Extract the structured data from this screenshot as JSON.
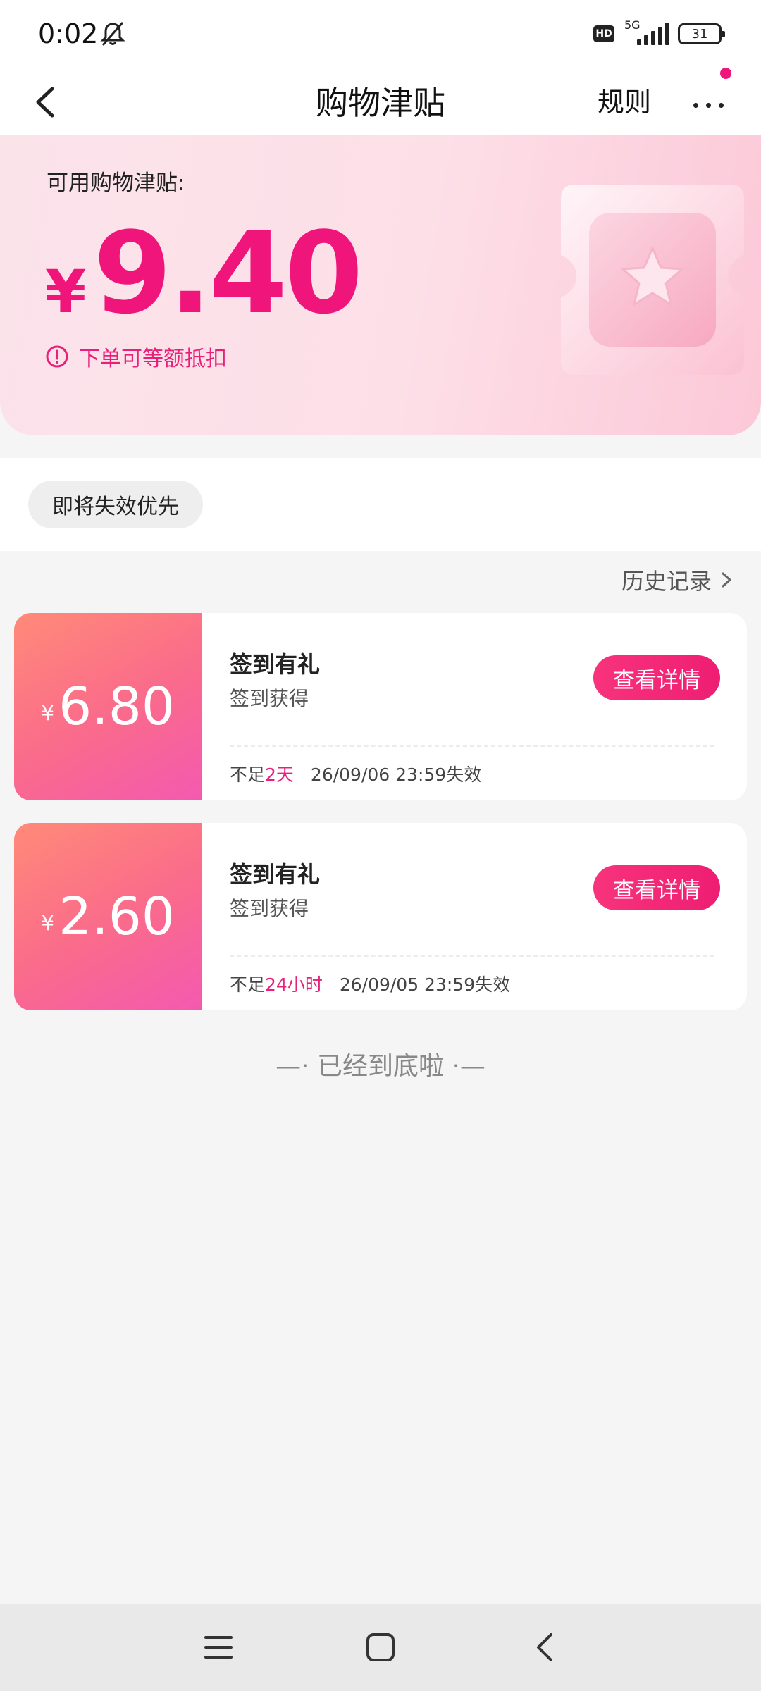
{
  "status_bar": {
    "time": "0:02",
    "network_type": "5G",
    "hd_label": "HD",
    "battery_level": "31",
    "icons": [
      "bell-muted-icon",
      "hd-icon",
      "signal-icon",
      "battery-icon"
    ]
  },
  "nav": {
    "title": "购物津贴",
    "rule_label": "规则",
    "has_notification_dot": true
  },
  "hero": {
    "label": "可用购物津贴:",
    "currency": "¥",
    "amount": "9.40",
    "note": "下单可等额抵扣"
  },
  "filter": {
    "chip_label": "即将失效优先"
  },
  "history_link": "历史记录",
  "coupons": [
    {
      "currency": "¥",
      "amount": "6.80",
      "title": "签到有礼",
      "subtitle": "签到获得",
      "button": "查看详情",
      "prefix": "不足",
      "remaining": "2天",
      "expiry": "26/09/06 23:59失效"
    },
    {
      "currency": "¥",
      "amount": "2.60",
      "title": "签到有礼",
      "subtitle": "签到获得",
      "button": "查看详情",
      "prefix": "不足",
      "remaining": "24小时",
      "expiry": "26/09/05 23:59失效"
    }
  ],
  "end_text": "—· 已经到底啦 ·—",
  "colors": {
    "accent": "#f0157a",
    "card_gradient_start": "#ff8a78",
    "card_gradient_end": "#f35ab0",
    "hero_background": "#fddfe8"
  }
}
